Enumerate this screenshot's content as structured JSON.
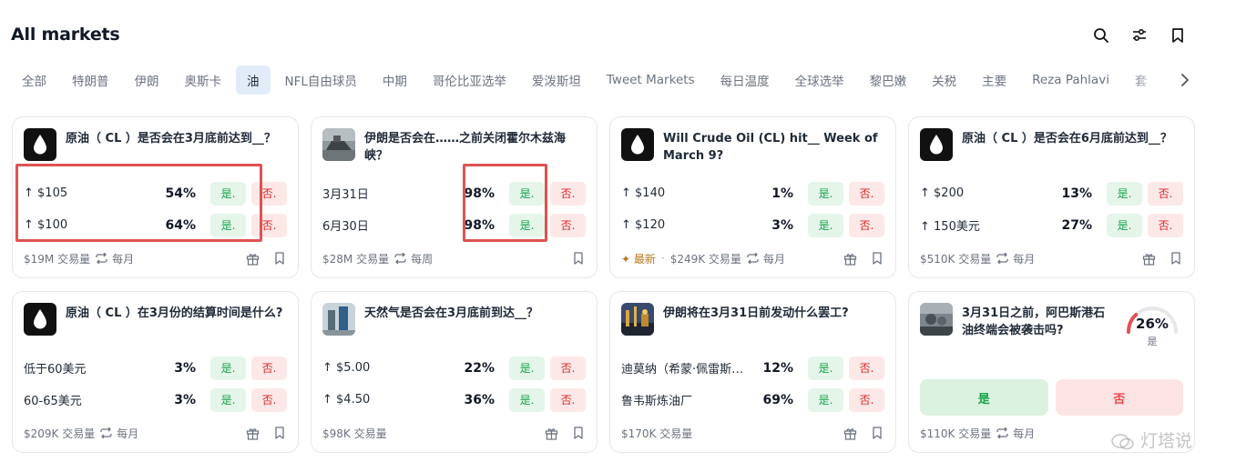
{
  "header": {
    "title": "All markets"
  },
  "tabs": [
    "全部",
    "特朗普",
    "伊朗",
    "奥斯卡",
    "油",
    "NFL自由球员",
    "中期",
    "哥伦比亚选举",
    "爱泼斯坦",
    "Tweet Markets",
    "每日温度",
    "全球选举",
    "黎巴嫩",
    "关税",
    "主要",
    "Reza Pahlavi",
    "套"
  ],
  "active_tab": "油",
  "buttons": {
    "yes": "是.",
    "no": "否."
  },
  "cards": [
    {
      "question": "原油（ CL ）是否会在3月底前达到__？",
      "rows": [
        {
          "label": "↑ $105",
          "pct": "54%"
        },
        {
          "label": "↑ $100",
          "pct": "64%"
        }
      ],
      "volume": "$19M 交易量",
      "freq": "每月"
    },
    {
      "question": "伊朗是否会在……之前关闭霍尔木兹海峡？",
      "rows": [
        {
          "label": "3月31日",
          "pct": "98%"
        },
        {
          "label": "6月30日",
          "pct": "98%"
        }
      ],
      "volume": "$28M 交易量",
      "freq": "每周"
    },
    {
      "question": "Will Crude Oil (CL) hit__ Week of March 9?",
      "rows": [
        {
          "label": "↑ $140",
          "pct": "1%"
        },
        {
          "label": "↑ $120",
          "pct": "3%"
        }
      ],
      "new_label": "✦ 最新",
      "volume": "$249K 交易量",
      "freq": "每月"
    },
    {
      "question": "原油（ CL ）是否会在6月底前达到__？",
      "rows": [
        {
          "label": "↑ $200",
          "pct": "13%"
        },
        {
          "label": "↑ 150美元",
          "pct": "27%"
        }
      ],
      "volume": "$510K 交易量",
      "freq": "每月"
    },
    {
      "question": "原油（ CL ）在3月份的结算时间是什么?",
      "rows": [
        {
          "label": "低于60美元",
          "pct": "3%"
        },
        {
          "label": "60-65美元",
          "pct": "3%"
        }
      ],
      "volume": "$209K 交易量",
      "freq": "每月"
    },
    {
      "question": "天然气是否会在3月底前到达__？",
      "rows": [
        {
          "label": "↑ $5.00",
          "pct": "22%"
        },
        {
          "label": "↑ $4.50",
          "pct": "36%"
        }
      ],
      "volume": "$98K 交易量"
    },
    {
      "question": "伊朗将在3月31日前发动什么罢工?",
      "rows": [
        {
          "label": "迪莫纳（希蒙·佩雷斯…",
          "pct": "12%"
        },
        {
          "label": "鲁韦斯炼油厂",
          "pct": "69%"
        }
      ],
      "volume": "$170K 交易量"
    },
    {
      "question": "3月31日之前，阿巴斯港石油终端会被袭击吗?",
      "gauge": {
        "value": 0.26,
        "pct": "26%",
        "label": "是"
      },
      "yes": "是",
      "no": "否",
      "volume": "$110K 交易量",
      "freq": "每月"
    }
  ],
  "watermark": "灯塔说",
  "colors": {
    "yes": "#16a34a",
    "no": "#dc2626",
    "highlight": "#e05252",
    "active_tab_bg": "#e2ecf8"
  }
}
